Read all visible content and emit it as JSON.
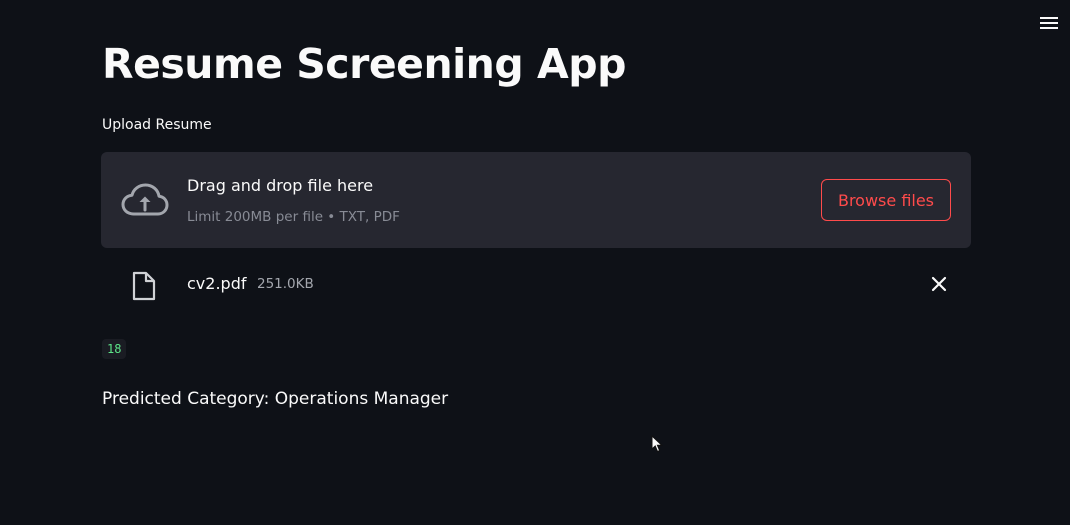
{
  "header": {
    "menu_icon": "hamburger-menu-icon"
  },
  "main": {
    "title": "Resume Screening App",
    "uploader": {
      "label": "Upload Resume",
      "drop_title": "Drag and drop file here",
      "drop_limit": "Limit 200MB per file • TXT, PDF",
      "browse_label": "Browse files",
      "upload_icon": "cloud-upload-icon"
    },
    "uploaded_file": {
      "name": "cv2.pdf",
      "size": "251.0KB",
      "file_icon": "file-icon",
      "remove_icon": "close-icon"
    },
    "output_code": "18",
    "prediction": "Predicted Category: Operations Manager"
  },
  "colors": {
    "background": "#0e1117",
    "dropzone": "#262730",
    "accent": "#ff4b4b",
    "code_text": "#5ce488"
  }
}
